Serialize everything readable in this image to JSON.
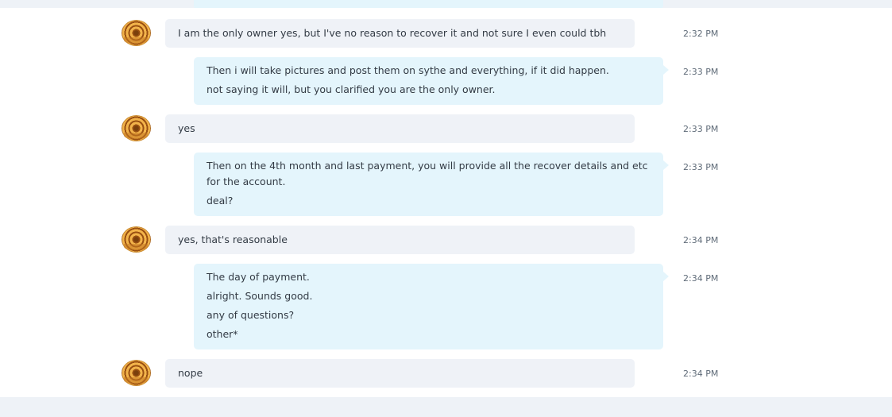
{
  "conversation": {
    "messages": [
      {
        "direction": "incoming",
        "time": "2:32 PM",
        "lines": [
          "I am the only owner yes, but I've no reason to recover it and not sure I even could tbh"
        ]
      },
      {
        "direction": "outgoing",
        "time": "2:33 PM",
        "lines": [
          "Then i will take pictures and post them on sythe and everything, if it did happen.",
          "not saying it will, but you clarified you are the only owner."
        ]
      },
      {
        "direction": "incoming",
        "time": "2:33 PM",
        "lines": [
          "yes"
        ]
      },
      {
        "direction": "outgoing",
        "time": "2:33 PM",
        "lines": [
          "Then on the 4th month and last payment, you will provide all the recover details and etc for the account.",
          "deal?"
        ]
      },
      {
        "direction": "incoming",
        "time": "2:34 PM",
        "lines": [
          "yes, that's reasonable"
        ]
      },
      {
        "direction": "outgoing",
        "time": "2:34 PM",
        "lines": [
          "The day of payment.",
          "alright. Sounds good.",
          "any of questions?",
          "other*"
        ]
      },
      {
        "direction": "incoming",
        "time": "2:34 PM",
        "lines": [
          "nope"
        ]
      }
    ]
  }
}
